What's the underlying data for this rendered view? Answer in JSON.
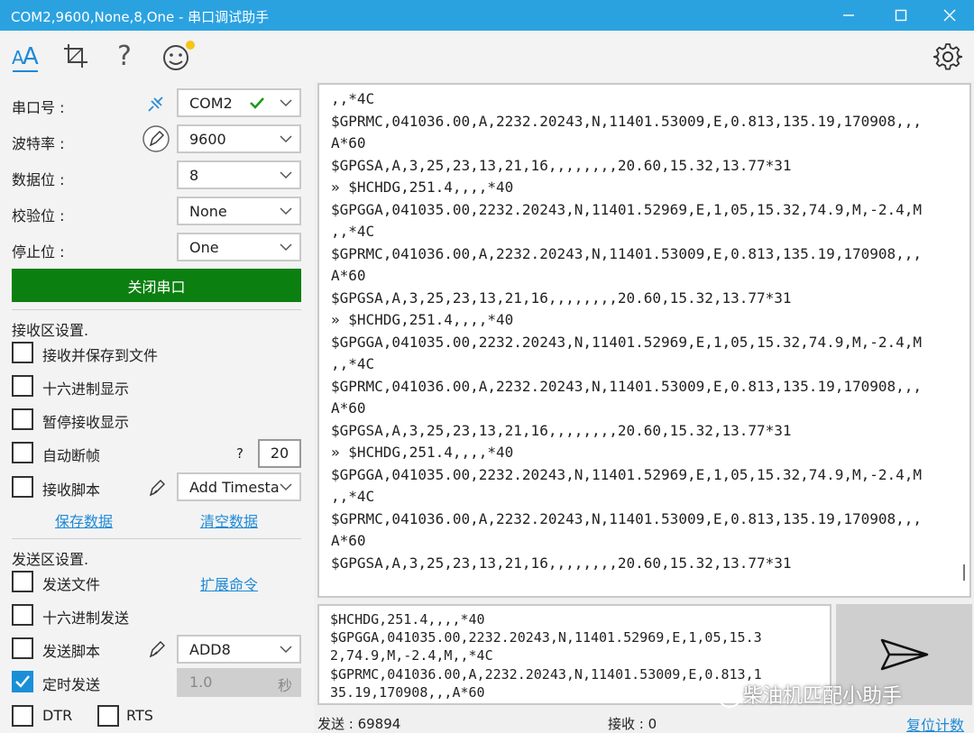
{
  "window": {
    "title": "COM2,9600,None,8,One - 串口调试助手",
    "accent": "#2ba2e0"
  },
  "toolbar": {
    "icons": [
      "font-size-icon",
      "crop-icon",
      "help-icon",
      "emoji-icon",
      "settings-icon"
    ],
    "help_glyph": "?"
  },
  "serial": {
    "port_label": "串口号 :",
    "port_value": "COM2",
    "baud_label": "波特率 :",
    "baud_value": "9600",
    "databits_label": "数据位 :",
    "databits_value": "8",
    "parity_label": "校验位 :",
    "parity_value": "None",
    "stopbits_label": "停止位 :",
    "stopbits_value": "One",
    "open_button": "关闭串口",
    "open_button_color": "#0b7f10"
  },
  "receive_settings": {
    "title": "接收区设置.",
    "save_to_file": "接收并保存到文件",
    "hex_display": "十六进制显示",
    "pause_display": "暂停接收显示",
    "auto_frame": "自动断帧",
    "auto_frame_help": "?",
    "auto_frame_value": "20",
    "script": "接收脚本",
    "script_value": "Add Timesta",
    "save_data": "保存数据",
    "clear_data": "清空数据"
  },
  "send_settings": {
    "title": "发送区设置.",
    "send_file": "发送文件",
    "extend_cmd": "扩展命令",
    "hex_send": "十六进制发送",
    "script": "发送脚本",
    "script_value": "ADD8",
    "timed_send": "定时发送",
    "timed_send_checked": true,
    "interval_value": "1.0",
    "interval_unit": "秒",
    "dtr": "DTR",
    "rts": "RTS"
  },
  "receive_area": {
    "lines": [
      ",,*4C",
      "$GPRMC,041036.00,A,2232.20243,N,11401.53009,E,0.813,135.19,170908,,,",
      "A*60",
      "$GPGSA,A,3,25,23,13,21,16,,,,,,,,20.60,15.32,13.77*31",
      "» $HCHDG,251.4,,,,*40",
      "$GPGGA,041035.00,2232.20243,N,11401.52969,E,1,05,15.32,74.9,M,-2.4,M",
      ",,*4C",
      "$GPRMC,041036.00,A,2232.20243,N,11401.53009,E,0.813,135.19,170908,,,",
      "A*60",
      "$GPGSA,A,3,25,23,13,21,16,,,,,,,,20.60,15.32,13.77*31",
      "» $HCHDG,251.4,,,,*40",
      "$GPGGA,041035.00,2232.20243,N,11401.52969,E,1,05,15.32,74.9,M,-2.4,M",
      ",,*4C",
      "$GPRMC,041036.00,A,2232.20243,N,11401.53009,E,0.813,135.19,170908,,,",
      "A*60",
      "$GPGSA,A,3,25,23,13,21,16,,,,,,,,20.60,15.32,13.77*31",
      "» $HCHDG,251.4,,,,*40",
      "$GPGGA,041035.00,2232.20243,N,11401.52969,E,1,05,15.32,74.9,M,-2.4,M",
      ",,*4C",
      "$GPRMC,041036.00,A,2232.20243,N,11401.53009,E,0.813,135.19,170908,,,",
      "A*60",
      "$GPGSA,A,3,25,23,13,21,16,,,,,,,,20.60,15.32,13.77*31"
    ]
  },
  "send_area": {
    "lines": [
      "$HCHDG,251.4,,,,*40",
      "$GPGGA,041035.00,2232.20243,N,11401.52969,E,1,05,15.3",
      "2,74.9,M,-2.4,M,,*4C",
      "$GPRMC,041036.00,A,2232.20243,N,11401.53009,E,0.813,1",
      "35.19,170908,,,A*60"
    ]
  },
  "status_bar": {
    "sent": "发送 : 69894",
    "received": "接收 : 0",
    "reset": "复位计数"
  },
  "watermark": {
    "text": "柴油机匹配小助手"
  }
}
